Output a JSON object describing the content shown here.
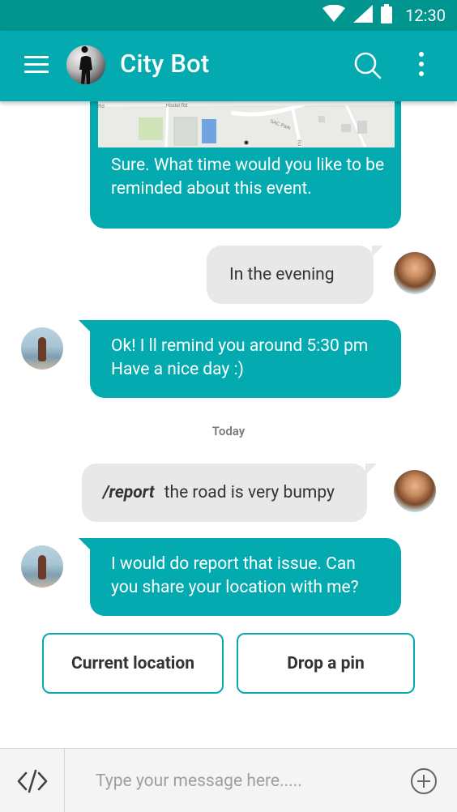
{
  "status_bar": {
    "time": "12:30"
  },
  "app_bar": {
    "title": "City Bot"
  },
  "messages": [
    {
      "sender": "bot",
      "text": "Sure. What time would you like to be reminded about this event."
    },
    {
      "sender": "user",
      "text": "In the evening"
    },
    {
      "sender": "bot",
      "text": "Ok! I ll remind you around 5:30 pm Have a nice day :)"
    },
    {
      "sender": "user",
      "command": "/report",
      "text": "the road is very bumpy"
    },
    {
      "sender": "bot",
      "text": "I would do report that issue. Can you share your location with me?"
    }
  ],
  "map_labels": {
    "road1": "Rd",
    "road2": "Hostel Rd",
    "road3": "SAC Park",
    "road4": "Rd"
  },
  "date_divider": "Today",
  "quick_replies": [
    {
      "label": "Current location"
    },
    {
      "label": "Drop a pin"
    }
  ],
  "composer": {
    "placeholder": "Type your message here....."
  },
  "colors": {
    "primary": "#03aab0",
    "status_bar": "#00968f",
    "user_bubble": "#e8e8e8"
  },
  "icons": {
    "menu": "menu-icon",
    "search": "search-icon",
    "more": "more-vertical-icon",
    "code": "code-icon",
    "add": "add-circle-icon"
  }
}
